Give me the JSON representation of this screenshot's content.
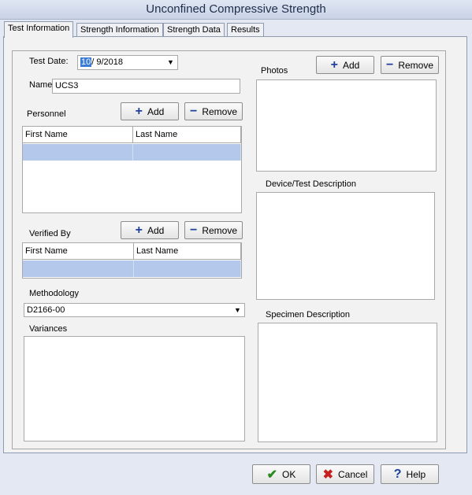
{
  "window": {
    "title": "Unconfined Compressive Strength"
  },
  "tabs": [
    {
      "label": "Test Information"
    },
    {
      "label": "Strength Information"
    },
    {
      "label": "Strength Data"
    },
    {
      "label": "Results"
    }
  ],
  "form": {
    "test_date_label": "Test Date:",
    "test_date_month": "10",
    "test_date_rest": "/  9/2018",
    "name_label": "Name:",
    "name_value": "UCS3",
    "personnel_label": "Personnel",
    "verified_by_label": "Verified By",
    "methodology_label": "Methodology",
    "methodology_value": "D2166-00",
    "variances_label": "Variances",
    "photos_label": "Photos",
    "device_label": "Device/Test Description",
    "specimen_label": "Specimen Description"
  },
  "buttons": {
    "add": "Add",
    "remove": "Remove",
    "ok": "OK",
    "cancel": "Cancel",
    "help": "Help"
  },
  "personnel_grid": {
    "columns": [
      "First Name",
      "Last Name"
    ]
  },
  "verified_grid": {
    "columns": [
      "First Name",
      "Last Name"
    ]
  },
  "icons": {
    "add": "plus-icon",
    "remove": "minus-icon",
    "dropdown": "chevron-down-icon",
    "ok": "checkmark-icon",
    "cancel": "x-icon",
    "help": "question-icon"
  },
  "colors": {
    "selection": "#b3c8ea",
    "accent": "#1e3f9a"
  }
}
